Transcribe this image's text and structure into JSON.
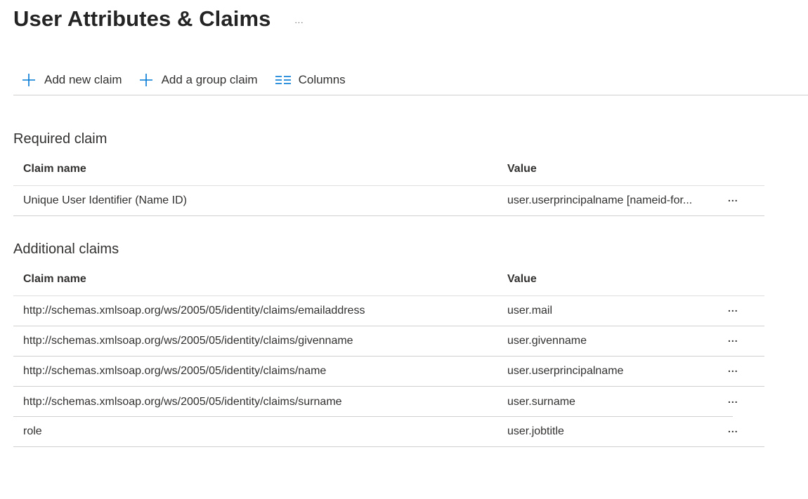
{
  "header": {
    "title": "User Attributes & Claims",
    "more": "..."
  },
  "toolbar": {
    "add_claim": "Add new claim",
    "add_group_claim": "Add a group claim",
    "columns": "Columns"
  },
  "required": {
    "title": "Required claim",
    "col_name": "Claim name",
    "col_value": "Value",
    "rows": [
      {
        "name": "Unique User Identifier (Name ID)",
        "value": "user.userprincipalname [nameid-for...",
        "more": "..."
      }
    ]
  },
  "additional": {
    "title": "Additional claims",
    "col_name": "Claim name",
    "col_value": "Value",
    "rows": [
      {
        "name": "http://schemas.xmlsoap.org/ws/2005/05/identity/claims/emailaddress",
        "value": "user.mail",
        "more": "..."
      },
      {
        "name": "http://schemas.xmlsoap.org/ws/2005/05/identity/claims/givenname",
        "value": "user.givenname",
        "more": "..."
      },
      {
        "name": "http://schemas.xmlsoap.org/ws/2005/05/identity/claims/name",
        "value": "user.userprincipalname",
        "more": "..."
      },
      {
        "name": "http://schemas.xmlsoap.org/ws/2005/05/identity/claims/surname",
        "value": "user.surname",
        "more": "..."
      },
      {
        "name": "role",
        "value": "user.jobtitle",
        "more": "..."
      }
    ]
  },
  "colors": {
    "accent": "#0078d4",
    "text": "#323130",
    "border": "#d2d0ce"
  },
  "icons": {
    "add": "plus-icon",
    "columns": "columns-icon",
    "more": "more-icon"
  }
}
